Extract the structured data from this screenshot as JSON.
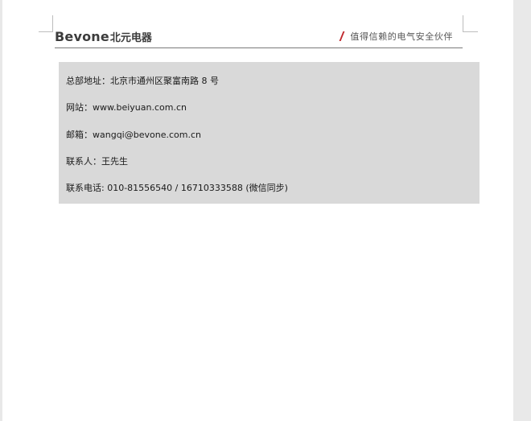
{
  "header": {
    "logo_latin": "Bevone",
    "logo_cn": "北元电器",
    "tagline": "值得信赖的电气安全伙伴"
  },
  "contact": {
    "address": "总部地址：北京市通州区聚富南路 8 号",
    "website": "网站：www.beiyuan.com.cn",
    "email": "邮箱：wangqi@bevone.com.cn",
    "contact_person": "联系人：王先生",
    "phone": "联系电话: 010-81556540 / 16710333588 (微信同步)"
  },
  "colors": {
    "accent_slash": "#c0282d",
    "box_background": "#d9d9d9"
  }
}
